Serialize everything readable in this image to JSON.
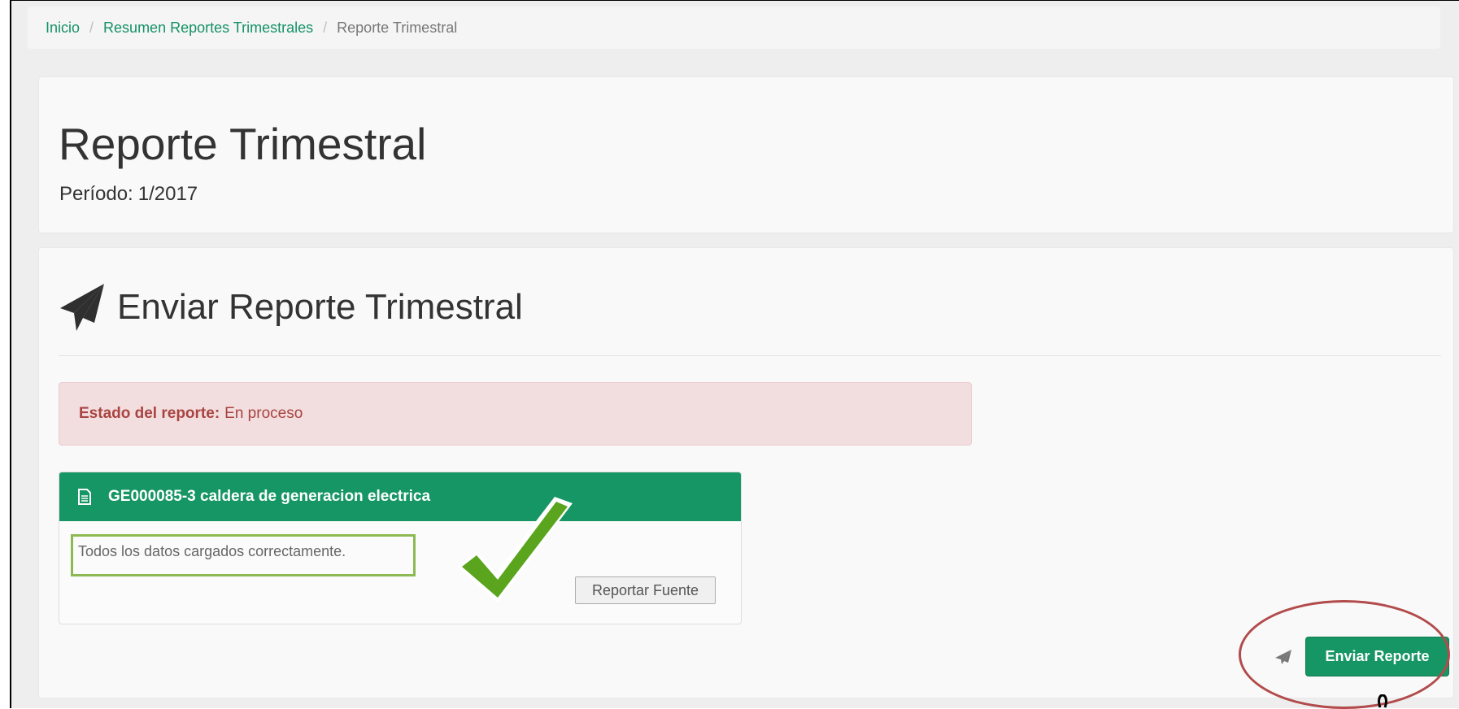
{
  "breadcrumb": {
    "home": "Inicio",
    "summary": "Resumen Reportes Trimestrales",
    "current": "Reporte Trimestral",
    "separator": "/"
  },
  "header": {
    "title": "Reporte Trimestral",
    "period_label": "Período:",
    "period_value": "1/2017"
  },
  "send_section": {
    "title": "Enviar Reporte Trimestral",
    "status": {
      "label": "Estado del reporte:",
      "value": "En proceso"
    },
    "source": {
      "title": "GE000085-3 caldera de generacion electrica",
      "message": "Todos los datos cargados correctamente.",
      "report_button": "Reportar Fuente"
    },
    "send_button": "Enviar Reporte"
  },
  "colors": {
    "accent_green": "#169664",
    "alert_bg": "#f2dede",
    "alert_text": "#a94442",
    "highlight_box": "#8db952",
    "annotation_circle": "#b24b4b"
  },
  "icons": {
    "section_icon": "paper-plane-icon",
    "source_icon": "document-icon",
    "button_icon": "paper-plane-icon",
    "annotation": "checkmark-icon"
  }
}
